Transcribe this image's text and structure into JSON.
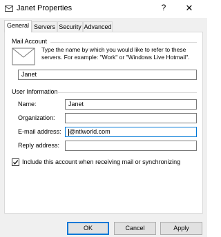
{
  "window": {
    "title": "Janet Properties",
    "help_glyph": "?",
    "close_glyph": "✕"
  },
  "tabs": [
    {
      "label": "General",
      "active": true
    },
    {
      "label": "Servers",
      "active": false
    },
    {
      "label": "Security",
      "active": false
    },
    {
      "label": "Advanced",
      "active": false
    }
  ],
  "mail_account": {
    "heading": "Mail Account",
    "description": "Type the name by which you would like to refer to these servers.  For example: \"Work\" or \"Windows Live Hotmail\".",
    "account_name": "Janet"
  },
  "user_information": {
    "heading": "User Information",
    "fields": [
      {
        "label": "Name:",
        "value": ""
      },
      {
        "label": "Organization:",
        "value": ""
      },
      {
        "label": "E-mail address:",
        "value": ""
      },
      {
        "label": "Reply address:",
        "value": ""
      }
    ],
    "name_value": "Janet",
    "organization_value": "",
    "email_value": "@ntlworld.com",
    "reply_value": ""
  },
  "options": {
    "include_label": "Include this account when receiving mail or synchronizing",
    "include_checked": true
  },
  "buttons": {
    "ok": "OK",
    "cancel": "Cancel",
    "apply": "Apply"
  }
}
